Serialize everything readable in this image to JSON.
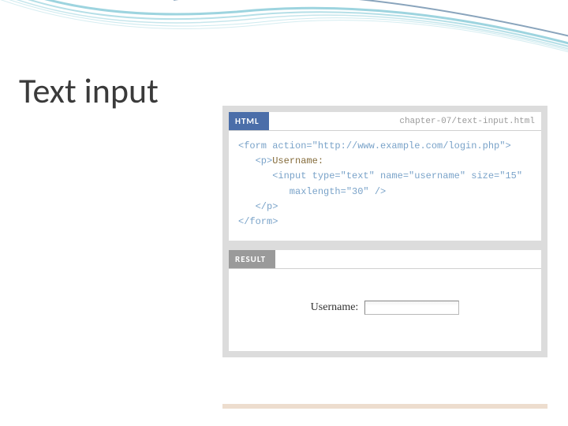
{
  "slide": {
    "title": "Text input"
  },
  "example": {
    "html_badge": "HTML",
    "filename": "chapter-07/text-input.html",
    "code": {
      "l1": "<form action=\"http://www.example.com/login.php\">",
      "l2": "   <p>",
      "l2b": "Username:",
      "l3": "      <input type=\"text\" name=\"username\" size=\"15\"",
      "l4": "         maxlength=\"30\" />",
      "l5": "   </p>",
      "l6": "</form>"
    },
    "result_badge": "RESULT",
    "result_label": "Username:"
  }
}
